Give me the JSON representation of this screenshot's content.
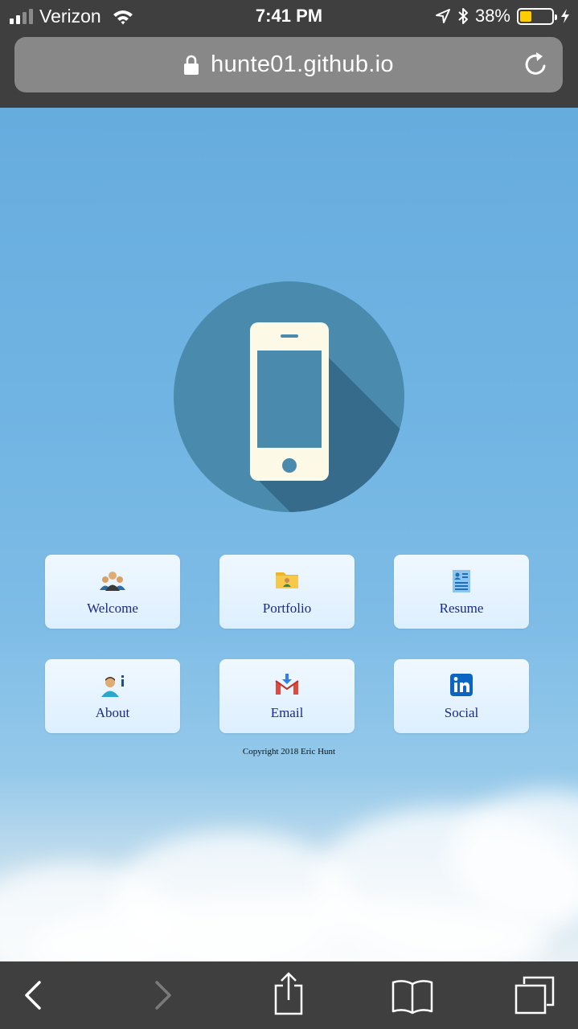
{
  "status_bar": {
    "carrier": "Verizon",
    "time": "7:41 PM",
    "battery_percent": "38%",
    "signal_bars_filled": 2,
    "signal_bars_total": 4,
    "battery_level": 0.38,
    "battery_color": "#ffcc00"
  },
  "browser": {
    "url": "hunte01.github.io"
  },
  "hero": {
    "icon": "smartphone-icon",
    "circle_color": "#4a8bad",
    "shadow_color": "#366b8c",
    "phone_color": "#fdf9e7"
  },
  "tiles": [
    {
      "label": "Welcome",
      "icon": "group-icon"
    },
    {
      "label": "Portfolio",
      "icon": "folder-icon"
    },
    {
      "label": "Resume",
      "icon": "document-icon"
    },
    {
      "label": "About",
      "icon": "person-info-icon"
    },
    {
      "label": "Email",
      "icon": "gmail-icon"
    },
    {
      "label": "Social",
      "icon": "linkedin-icon"
    }
  ],
  "footer": {
    "copyright": "Copyright 2018 Eric Hunt"
  },
  "toolbar": {
    "icons": [
      "back-icon",
      "forward-icon",
      "share-icon",
      "bookmarks-icon",
      "tabs-icon"
    ]
  },
  "colors": {
    "chrome": "#3f3f3f",
    "tile_label": "#1a2a8c",
    "sky": "#6cb0df"
  }
}
